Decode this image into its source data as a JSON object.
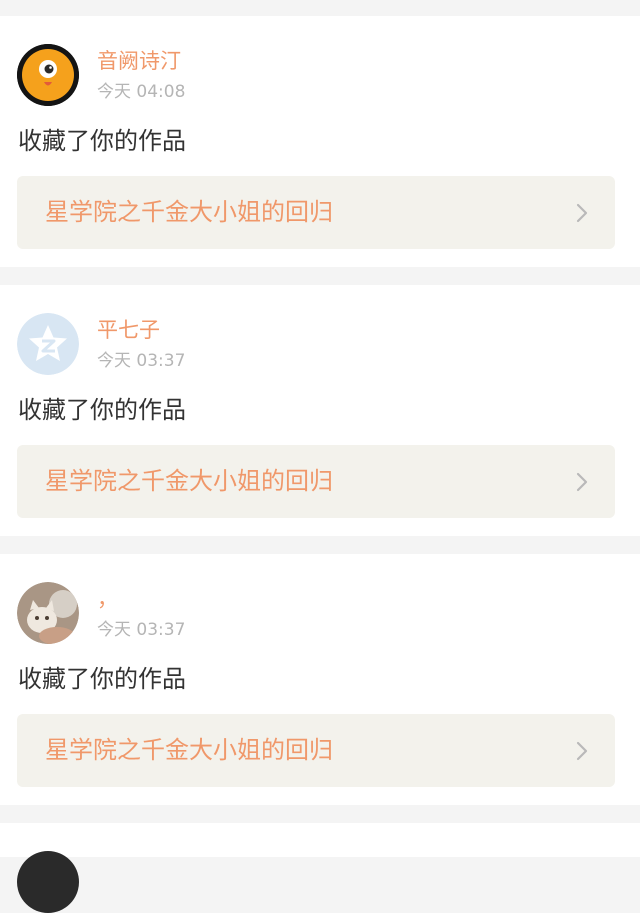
{
  "colors": {
    "accent": "#f0986a",
    "time": "#b5b5b5",
    "action_text": "#333333",
    "link_bg": "#f3f2ec",
    "page_bg": "#f4f4f4"
  },
  "notifications": [
    {
      "username": "音阙诗汀",
      "time": "今天 04:08",
      "action": "收藏了你的作品",
      "work_title": "星学院之千金大小姐的回归",
      "avatar_icon": "orange-one-eyed-monster-avatar"
    },
    {
      "username": "平七子",
      "time": "今天 03:37",
      "action": "收藏了你的作品",
      "work_title": "星学院之千金大小姐的回归",
      "avatar_icon": "default-qzone-star-avatar"
    },
    {
      "username": "，",
      "time": "今天 03:37",
      "action": "收藏了你的作品",
      "work_title": "星学院之千金大小姐的回归",
      "avatar_icon": "photo-avatar-cat"
    }
  ]
}
